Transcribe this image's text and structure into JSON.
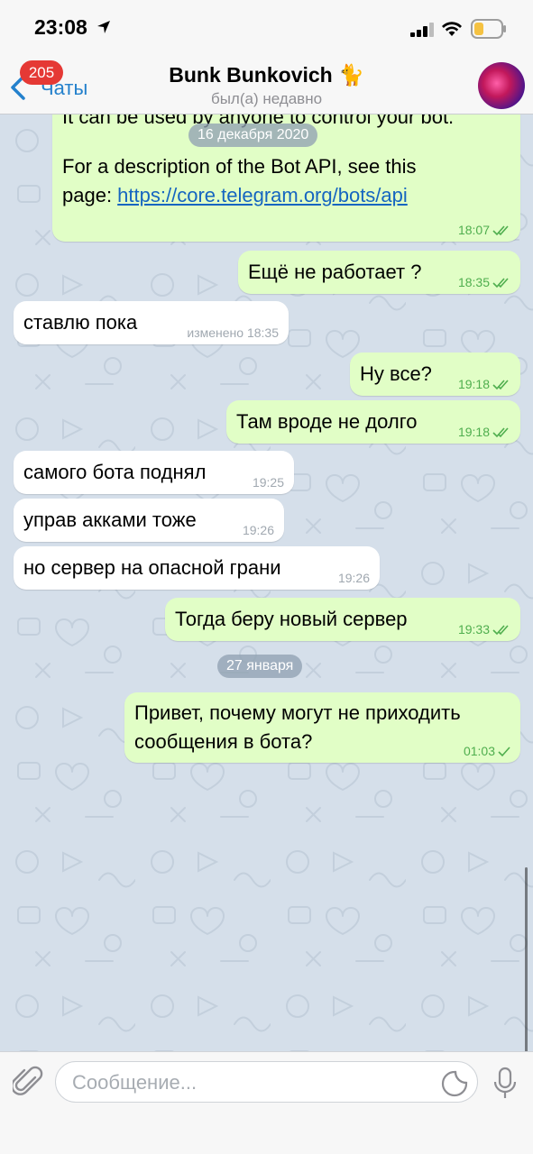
{
  "status_bar": {
    "time": "23:08"
  },
  "header": {
    "back_label": "Чаты",
    "unread_badge": "205",
    "title": "Bunk Bunkovich 🐈",
    "subtitle": "был(а) недавно"
  },
  "chat": {
    "first_bubble": {
      "partial_line": "It can be used by anyone to control your bot.",
      "line1": "For a description of the Bot API, see this",
      "line2_prefix": "page: ",
      "link": "https://core.telegram.org/bots/api",
      "time": "18:07"
    },
    "date_dec": "16 декабря 2020",
    "messages": [
      {
        "text": "Ещё не работает ?",
        "time": "18:35"
      },
      {
        "text": "ставлю пока",
        "time": "изменено 18:35"
      },
      {
        "text": "Ну все?",
        "time": "19:18"
      },
      {
        "text": "Там вроде не долго",
        "time": "19:18"
      },
      {
        "text": "самого бота поднял",
        "time": "19:25"
      },
      {
        "text": "управ акками тоже",
        "time": "19:26"
      },
      {
        "text": "но сервер на опасной грани",
        "time": "19:26"
      },
      {
        "text": "Тогда беру новый сервер",
        "time": "19:33"
      }
    ],
    "date_jan": "27 января",
    "last_message": {
      "line1": "Привет, почему могут не приходить",
      "line2": "сообщения в бота?",
      "time": "01:03"
    }
  },
  "input": {
    "placeholder": "Сообщение..."
  },
  "colors": {
    "outgoing_bubble": "#e1fec6",
    "incoming_bubble": "#ffffff",
    "accent": "#2481cc",
    "badge": "#e53935",
    "chat_background": "#d5dfea"
  },
  "icons": [
    "location-arrow-icon",
    "signal-icon",
    "wifi-icon",
    "battery-icon",
    "chevron-left-icon",
    "attach-icon",
    "sticker-icon",
    "microphone-icon",
    "double-check-icon",
    "single-check-icon"
  ]
}
